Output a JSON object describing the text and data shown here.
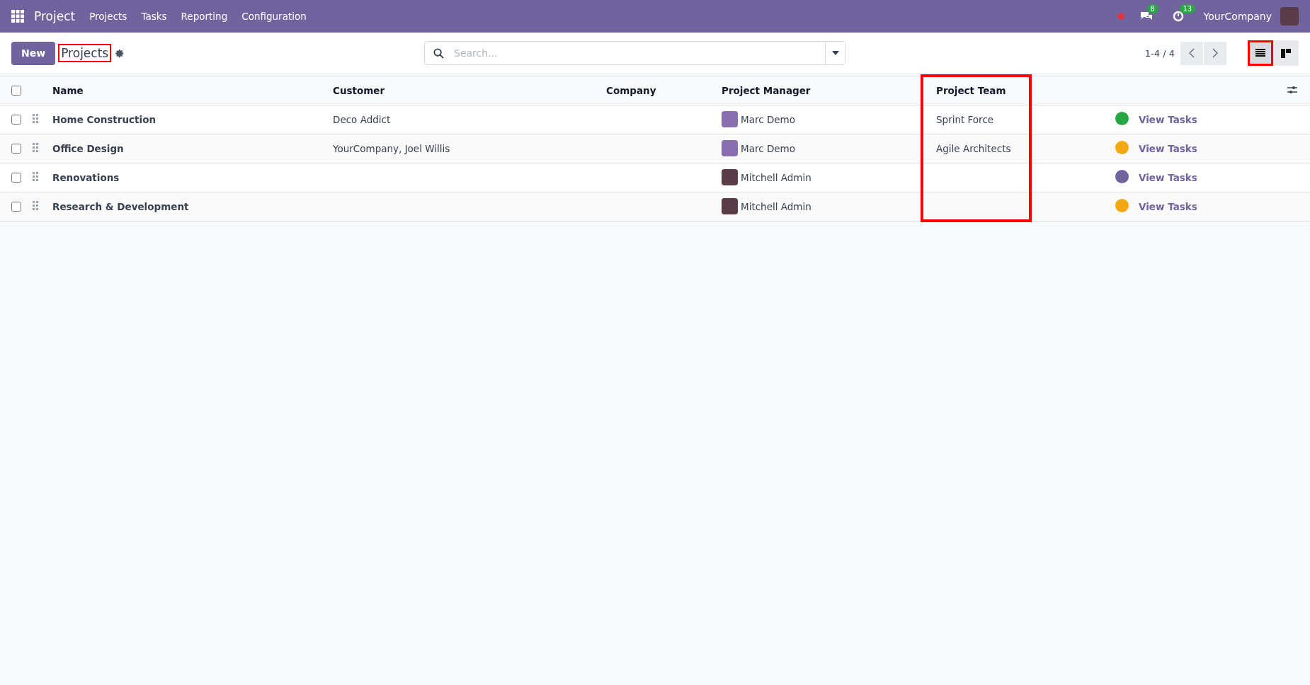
{
  "navbar": {
    "app_name": "Project",
    "menu": [
      "Projects",
      "Tasks",
      "Reporting",
      "Configuration"
    ],
    "messages_count": "8",
    "activities_count": "13",
    "company": "YourCompany"
  },
  "control_panel": {
    "new_button": "New",
    "breadcrumb": {
      "label": "Projects",
      "highlighted": true
    },
    "search": {
      "placeholder": "Search..."
    },
    "pager": "1-4 / 4",
    "views": [
      {
        "kind": "list",
        "selected": true,
        "highlighted": true
      },
      {
        "kind": "kanban",
        "selected": false,
        "highlighted": false
      }
    ]
  },
  "table": {
    "select_all_checked": false,
    "columns": [
      {
        "label": "Name",
        "highlighted": false
      },
      {
        "label": "Customer",
        "highlighted": false
      },
      {
        "label": "Company",
        "highlighted": false
      },
      {
        "label": "Project Manager",
        "highlighted": false
      },
      {
        "label": "Project Team",
        "highlighted": true
      }
    ],
    "rows": [
      {
        "checked": false,
        "name": "Home Construction",
        "customer": "Deco Addict",
        "manager": "Marc Demo",
        "team": "Sprint Force",
        "color": "#28a745",
        "link": "View Tasks"
      },
      {
        "checked": false,
        "name": "Office Design",
        "customer": "YourCompany, Joel Willis",
        "manager": "Marc Demo",
        "team": "Agile Architects",
        "color": "#f3a712",
        "link": "View Tasks"
      },
      {
        "checked": false,
        "name": "Renovations",
        "manager": "Mitchell Admin",
        "color": "#71639e",
        "link": "View Tasks"
      },
      {
        "checked": false,
        "name": "Research & Development",
        "manager": "Mitchell Admin",
        "color": "#f3a712",
        "link": "View Tasks"
      }
    ]
  }
}
